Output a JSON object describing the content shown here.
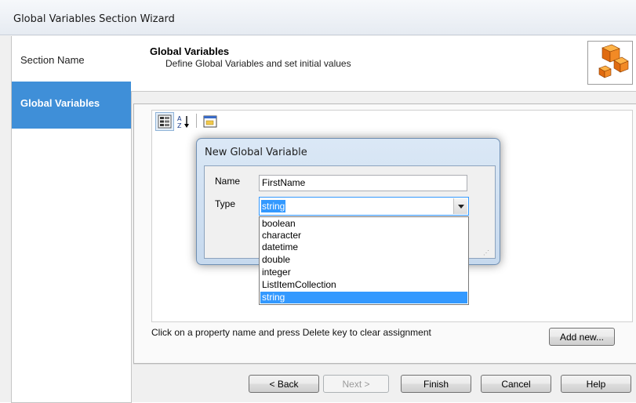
{
  "window": {
    "title": "Global Variables Section Wizard"
  },
  "nav": {
    "items": [
      {
        "label": "Section Name"
      },
      {
        "label": "Global Variables"
      }
    ]
  },
  "header": {
    "title": "Global Variables",
    "subtitle": "Define Global Variables and set initial values",
    "icon": "cubes-icon"
  },
  "toolbar": {
    "icons": [
      "categorized-icon",
      "alphabetical-sort-icon",
      "property-pages-icon"
    ]
  },
  "hint": "Click on a property name and press Delete key to clear assignment",
  "add_new_label": "Add new...",
  "buttons": {
    "back": "< Back",
    "next": "Next >",
    "finish": "Finish",
    "cancel": "Cancel",
    "help": "Help"
  },
  "dialog": {
    "title": "New Global Variable",
    "name_label": "Name",
    "name_value": "FirstName",
    "type_label": "Type",
    "type_value": "string",
    "type_options": [
      "boolean",
      "character",
      "datetime",
      "double",
      "integer",
      "ListItemCollection",
      "string"
    ],
    "selected_option": "string"
  },
  "colors": {
    "accent": "#3f8fd8",
    "selection": "#3399ff"
  }
}
